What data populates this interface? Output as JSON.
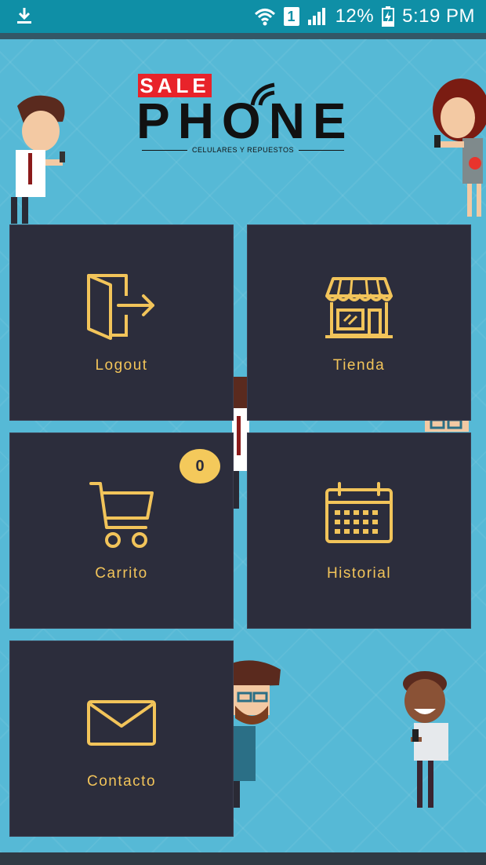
{
  "status_bar": {
    "signal_sim": "1",
    "battery": "12%",
    "time": "5:19 PM"
  },
  "logo": {
    "sale": "SALE",
    "phone": "PHONE",
    "tagline": "CELULARES Y REPUESTOS"
  },
  "tiles": [
    {
      "label": "Logout",
      "icon": "logout-icon"
    },
    {
      "label": "Tienda",
      "icon": "store-icon"
    },
    {
      "label": "Carrito",
      "icon": "cart-icon",
      "badge": "0"
    },
    {
      "label": "Historial",
      "icon": "calendar-icon"
    },
    {
      "label": "Contacto",
      "icon": "mail-icon"
    }
  ],
  "colors": {
    "background": "#55b8d4",
    "tile": "#2c2d3c",
    "accent": "#f2c45a",
    "status_bar": "#0f8fa6"
  }
}
